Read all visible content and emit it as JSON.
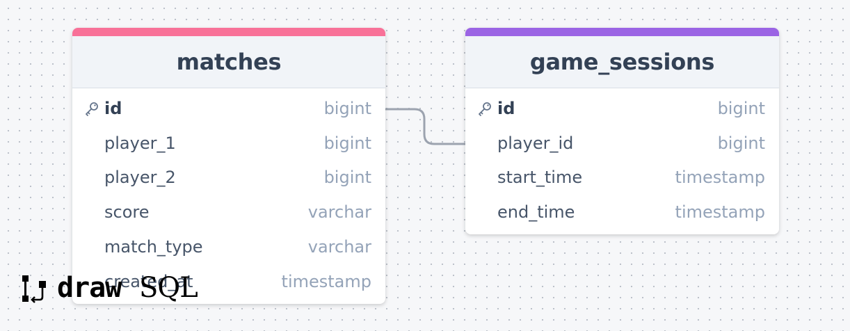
{
  "colors": {
    "matches_accent": "#f87198",
    "game_sessions_accent": "#9b64e4",
    "relation_line": "#9ca3af",
    "canvas_dot": "#b9bec7"
  },
  "tables": {
    "matches": {
      "name": "matches",
      "columns": [
        {
          "name": "id",
          "type": "bigint",
          "primary_key": true
        },
        {
          "name": "player_1",
          "type": "bigint"
        },
        {
          "name": "player_2",
          "type": "bigint"
        },
        {
          "name": "score",
          "type": "varchar"
        },
        {
          "name": "match_type",
          "type": "varchar"
        },
        {
          "name": "created_at",
          "type": "timestamp"
        }
      ]
    },
    "game_sessions": {
      "name": "game_sessions",
      "columns": [
        {
          "name": "id",
          "type": "bigint",
          "primary_key": true
        },
        {
          "name": "player_id",
          "type": "bigint"
        },
        {
          "name": "start_time",
          "type": "timestamp"
        },
        {
          "name": "end_time",
          "type": "timestamp"
        }
      ]
    }
  },
  "relations": [
    {
      "from": "matches.id",
      "to": "game_sessions.player_id"
    }
  ],
  "logo": {
    "part1": "draw",
    "part2": "SQL"
  }
}
